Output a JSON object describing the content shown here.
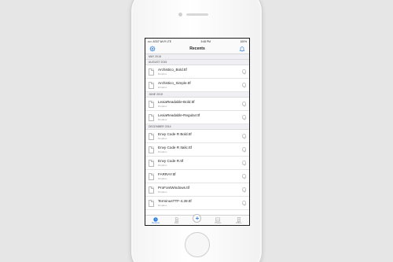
{
  "status": {
    "carrier": "••••◦ AT&T Wi-Fi LTE",
    "time": "5:48 PM",
    "battery": "100%"
  },
  "navbar": {
    "title": "Recents",
    "left_icon": "gear-icon",
    "right_icon": "bell-icon"
  },
  "sections": [
    {
      "header": "MAY 2016",
      "items": []
    },
    {
      "header": "AUGUST 2015",
      "items": [
        {
          "name": "Archistico_Bold.ttf",
          "source": "Dropbox"
        },
        {
          "name": "Archistico_Simple.ttf",
          "source": "Dropbox"
        }
      ]
    },
    {
      "header": "JUNE 2015",
      "items": [
        {
          "name": "LexiaReadable-Bold.ttf",
          "source": "Dropbox"
        },
        {
          "name": "LexiaReadable-Regular.ttf",
          "source": "Dropbox"
        }
      ]
    },
    {
      "header": "DECEMBER 2014",
      "items": [
        {
          "name": "Envy Code R Bold.ttf",
          "source": "Dropbox"
        },
        {
          "name": "Envy Code R Italic.ttf",
          "source": "Dropbox"
        },
        {
          "name": "Envy Code R.ttf",
          "source": "Dropbox"
        },
        {
          "name": "FARRAY.ttf",
          "source": "Dropbox"
        },
        {
          "name": "ProFontWindows.ttf",
          "source": "Dropbox"
        },
        {
          "name": "TerminusTTF-4.39.ttf",
          "source": "Dropbox"
        }
      ]
    }
  ],
  "tabbar": {
    "tabs": [
      {
        "label": "Recents",
        "icon": "clock-icon",
        "active": true
      },
      {
        "label": "Files",
        "icon": "file-icon",
        "active": false
      },
      {
        "label": "",
        "icon": "plus-icon",
        "active": false
      },
      {
        "label": "Photos",
        "icon": "photo-icon",
        "active": false
      },
      {
        "label": "Offline",
        "icon": "offline-icon",
        "active": false
      }
    ],
    "add_symbol": "+"
  },
  "colors": {
    "accent": "#2b7de0",
    "section_bg": "#efeff4",
    "page_bg": "#e6e6e6"
  }
}
